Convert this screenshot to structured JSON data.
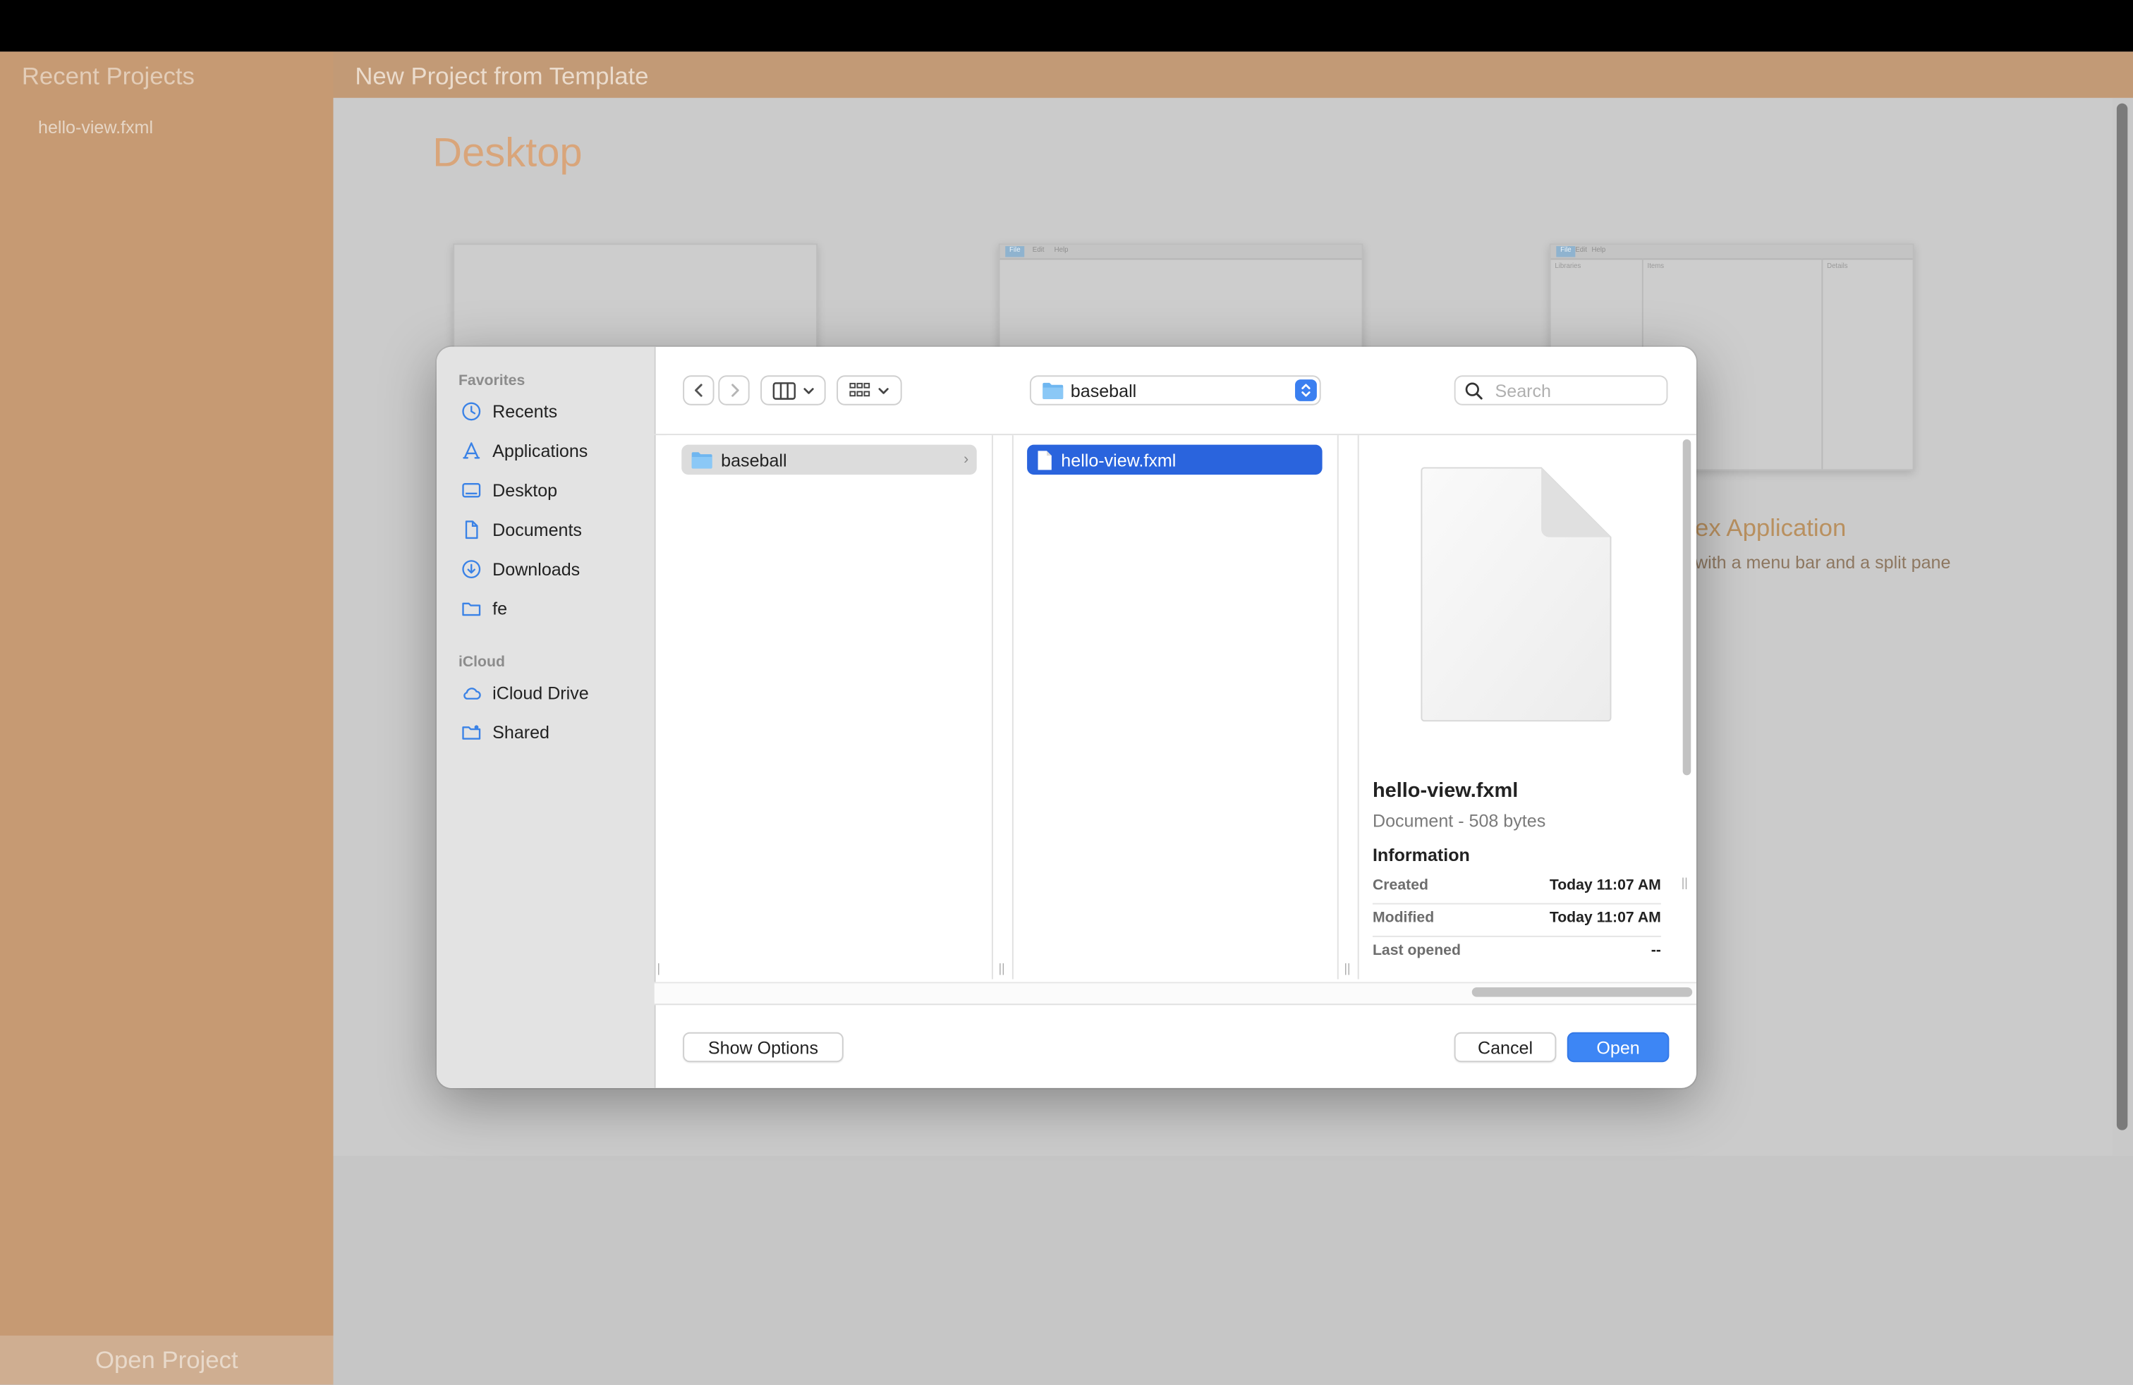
{
  "app": {
    "sidebar": {
      "title": "Recent Projects",
      "items": [
        "hello-view.fxml"
      ],
      "open_button": "Open Project"
    },
    "main": {
      "header_title": "New Project from Template",
      "section_title": "Desktop",
      "templates": [
        {
          "preview_menu": [
            "File",
            "Edit",
            "Help"
          ]
        },
        {
          "preview_menu": [
            "File",
            "Edit",
            "Help"
          ],
          "preview_panes": [
            "Libraries",
            "Items",
            "Details"
          ]
        }
      ],
      "visible_template_label": "ex Application",
      "visible_template_desc": "with a menu bar and a split pane"
    }
  },
  "dialog": {
    "sidebar": {
      "favorites_header": "Favorites",
      "favorites": [
        {
          "label": "Recents",
          "icon": "clock-icon"
        },
        {
          "label": "Applications",
          "icon": "applications-icon"
        },
        {
          "label": "Desktop",
          "icon": "desktop-icon"
        },
        {
          "label": "Documents",
          "icon": "document-icon"
        },
        {
          "label": "Downloads",
          "icon": "download-icon"
        },
        {
          "label": "fe",
          "icon": "folder-icon"
        }
      ],
      "icloud_header": "iCloud",
      "icloud": [
        {
          "label": "iCloud Drive",
          "icon": "cloud-icon"
        },
        {
          "label": "Shared",
          "icon": "shared-folder-icon"
        }
      ]
    },
    "toolbar": {
      "location": "baseball",
      "search_placeholder": "Search"
    },
    "columns": {
      "col1_item": "baseball",
      "col2_item": "hello-view.fxml"
    },
    "preview": {
      "name": "hello-view.fxml",
      "kind": "Document - 508 bytes",
      "info_header": "Information",
      "rows": [
        {
          "label": "Created",
          "value": "Today 11:07 AM"
        },
        {
          "label": "Modified",
          "value": "Today 11:07 AM"
        },
        {
          "label": "Last opened",
          "value": "--"
        }
      ]
    },
    "footer": {
      "show_options": "Show Options",
      "cancel": "Cancel",
      "open": "Open"
    },
    "colors": {
      "accent": "#3d86f5",
      "selection": "#2a64dd"
    }
  }
}
